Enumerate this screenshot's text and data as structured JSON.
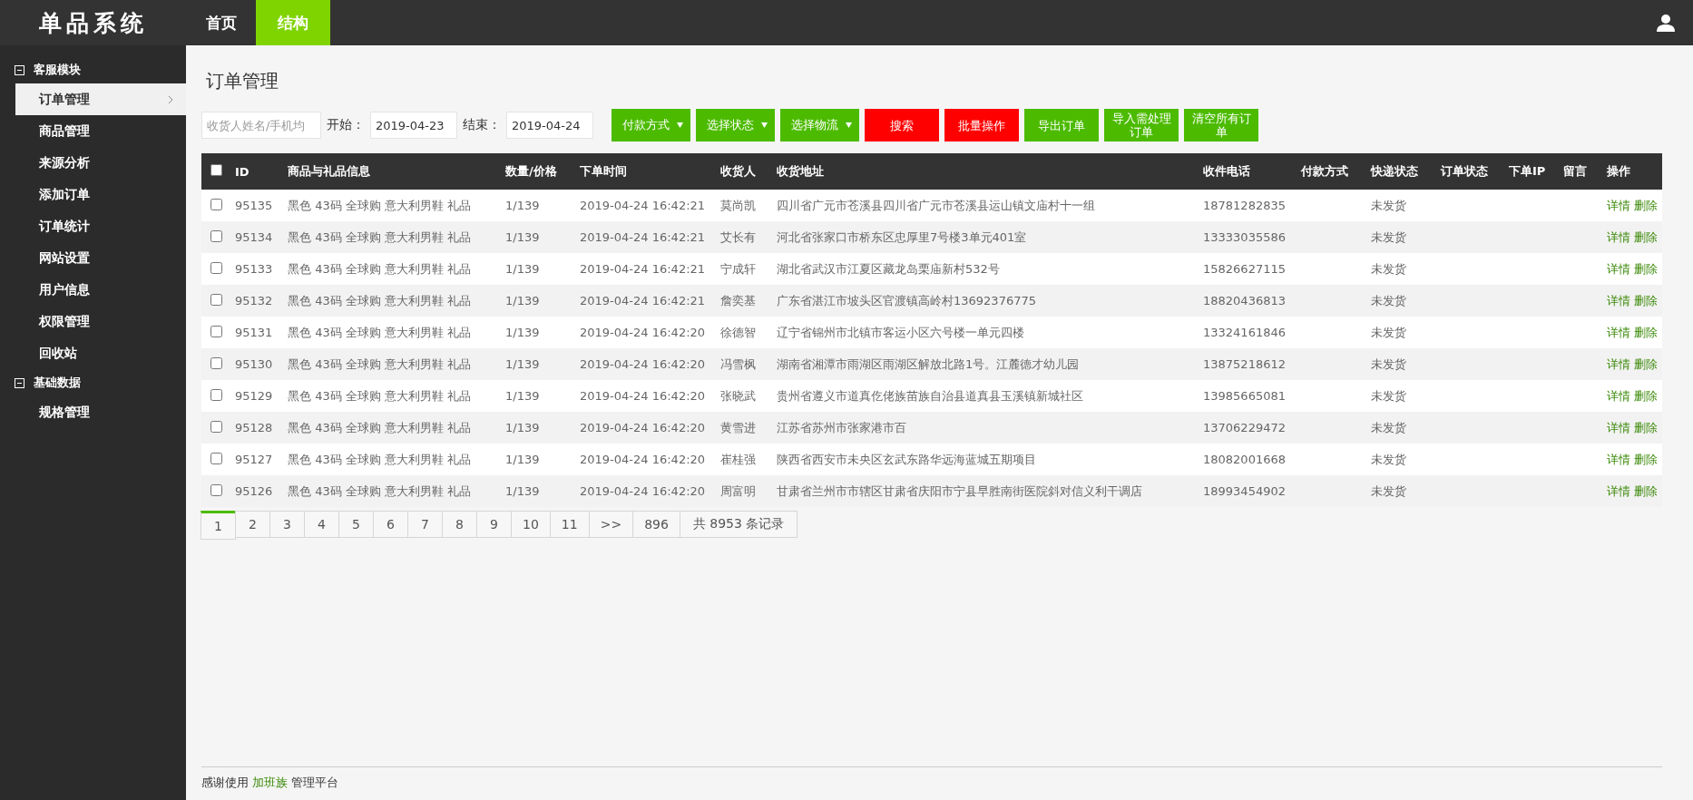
{
  "header": {
    "logo": "单品系统",
    "nav": [
      {
        "label": "首页",
        "selected": false
      },
      {
        "label": "结构",
        "selected": true
      }
    ]
  },
  "sidebar": {
    "groups": [
      {
        "title": "客服模块",
        "expanded": true,
        "items": [
          {
            "label": "订单管理",
            "selected": true
          },
          {
            "label": "商品管理",
            "selected": false
          },
          {
            "label": "来源分析",
            "selected": false
          },
          {
            "label": "添加订单",
            "selected": false
          },
          {
            "label": "订单统计",
            "selected": false
          },
          {
            "label": "网站设置",
            "selected": false
          },
          {
            "label": "用户信息",
            "selected": false
          },
          {
            "label": "权限管理",
            "selected": false
          },
          {
            "label": "回收站",
            "selected": false
          }
        ]
      },
      {
        "title": "基础数据",
        "expanded": true,
        "items": [
          {
            "label": "规格管理",
            "selected": false
          }
        ]
      }
    ]
  },
  "page_title": "订单管理",
  "filters": {
    "search": {
      "placeholder": "收货人姓名/手机均"
    },
    "start": {
      "label": "开始：",
      "value": "2019-04-23"
    },
    "end": {
      "label": "结束：",
      "value": "2019-04-24"
    },
    "dropdowns": [
      {
        "label": "付款方式"
      },
      {
        "label": "选择状态"
      },
      {
        "label": "选择物流"
      }
    ],
    "buttons": [
      {
        "label": "搜索",
        "kind": "danger"
      },
      {
        "label": "批量操作",
        "kind": "danger"
      },
      {
        "label": "导出订单",
        "kind": "primary"
      },
      {
        "label": "导入需处理订单",
        "kind": "primary"
      },
      {
        "label": "清空所有订单",
        "kind": "primary"
      }
    ]
  },
  "table": {
    "all_checked": false,
    "columns": [
      "ID",
      "商品与礼品信息",
      "数量/价格",
      "下单时间",
      "收货人",
      "收货地址",
      "收件电话",
      "付款方式",
      "快递状态",
      "订单状态",
      "下单IP",
      "留言",
      "操作"
    ],
    "rows": [
      {
        "checked": false,
        "id": "95135",
        "product": "黑色 43码 全球购 意大利男鞋 礼品",
        "qty_price": "1/139",
        "time": "2019-04-24 16:42:21",
        "receiver": "莫尚凯",
        "address": "四川省广元市苍溪县四川省广元市苍溪县运山镇文庙村十一组",
        "phone": "18781282835",
        "shipping": "未发货",
        "actions": [
          "详情",
          "删除"
        ]
      },
      {
        "checked": false,
        "id": "95134",
        "product": "黑色 43码 全球购 意大利男鞋 礼品",
        "qty_price": "1/139",
        "time": "2019-04-24 16:42:21",
        "receiver": "艾长有",
        "address": "河北省张家口市桥东区忠厚里7号楼3单元401室",
        "phone": "13333035586",
        "shipping": "未发货",
        "actions": [
          "详情",
          "删除"
        ]
      },
      {
        "checked": false,
        "id": "95133",
        "product": "黑色 43码 全球购 意大利男鞋 礼品",
        "qty_price": "1/139",
        "time": "2019-04-24 16:42:21",
        "receiver": "宁成轩",
        "address": "湖北省武汉市江夏区藏龙岛栗庙新村532号",
        "phone": "15826627115",
        "shipping": "未发货",
        "actions": [
          "详情",
          "删除"
        ]
      },
      {
        "checked": false,
        "id": "95132",
        "product": "黑色 43码 全球购 意大利男鞋 礼品",
        "qty_price": "1/139",
        "time": "2019-04-24 16:42:21",
        "receiver": "詹奕基",
        "address": "广东省湛江市坡头区官渡镇高岭村13692376775",
        "phone": "18820436813",
        "shipping": "未发货",
        "actions": [
          "详情",
          "删除"
        ]
      },
      {
        "checked": false,
        "id": "95131",
        "product": "黑色 43码 全球购 意大利男鞋 礼品",
        "qty_price": "1/139",
        "time": "2019-04-24 16:42:20",
        "receiver": "徐德智",
        "address": "辽宁省锦州市北镇市客运小区六号楼一单元四楼",
        "phone": "13324161846",
        "shipping": "未发货",
        "actions": [
          "详情",
          "删除"
        ]
      },
      {
        "checked": false,
        "id": "95130",
        "product": "黑色 43码 全球购 意大利男鞋 礼品",
        "qty_price": "1/139",
        "time": "2019-04-24 16:42:20",
        "receiver": "冯雪枫",
        "address": "湖南省湘潭市雨湖区雨湖区解放北路1号。江麓德才幼儿园",
        "phone": "13875218612",
        "shipping": "未发货",
        "actions": [
          "详情",
          "删除"
        ]
      },
      {
        "checked": false,
        "id": "95129",
        "product": "黑色 43码 全球购 意大利男鞋 礼品",
        "qty_price": "1/139",
        "time": "2019-04-24 16:42:20",
        "receiver": "张晓武",
        "address": "贵州省遵义市道真仡佬族苗族自治县道真县玉溪镇新城社区",
        "phone": "13985665081",
        "shipping": "未发货",
        "actions": [
          "详情",
          "删除"
        ]
      },
      {
        "checked": false,
        "id": "95128",
        "product": "黑色 43码 全球购 意大利男鞋 礼品",
        "qty_price": "1/139",
        "time": "2019-04-24 16:42:20",
        "receiver": "黄雪进",
        "address": "江苏省苏州市张家港市百",
        "phone": "13706229472",
        "shipping": "未发货",
        "actions": [
          "详情",
          "删除"
        ]
      },
      {
        "checked": false,
        "id": "95127",
        "product": "黑色 43码 全球购 意大利男鞋 礼品",
        "qty_price": "1/139",
        "time": "2019-04-24 16:42:20",
        "receiver": "崔桂强",
        "address": "陕西省西安市未央区玄武东路华远海蓝城五期项目",
        "phone": "18082001668",
        "shipping": "未发货",
        "actions": [
          "详情",
          "删除"
        ]
      },
      {
        "checked": false,
        "id": "95126",
        "product": "黑色 43码 全球购 意大利男鞋 礼品",
        "qty_price": "1/139",
        "time": "2019-04-24 16:42:20",
        "receiver": "周富明",
        "address": "甘肃省兰州市市辖区甘肃省庆阳市宁县早胜南街医院斜对信义利干调店",
        "phone": "18993454902",
        "shipping": "未发货",
        "actions": [
          "详情",
          "删除"
        ]
      }
    ]
  },
  "pagination": {
    "pages": [
      {
        "label": "1",
        "selected": true
      },
      {
        "label": "2",
        "selected": false
      },
      {
        "label": "3",
        "selected": false
      },
      {
        "label": "4",
        "selected": false
      },
      {
        "label": "5",
        "selected": false
      },
      {
        "label": "6",
        "selected": false
      },
      {
        "label": "7",
        "selected": false
      },
      {
        "label": "8",
        "selected": false
      },
      {
        "label": "9",
        "selected": false
      },
      {
        "label": "10",
        "selected": false
      },
      {
        "label": "11",
        "selected": false
      }
    ],
    "next": ">>",
    "last": "896",
    "total": "共 8953 条记录"
  },
  "footer": {
    "before": "感谢使用",
    "link": "加班族",
    "after": "管理平台"
  }
}
